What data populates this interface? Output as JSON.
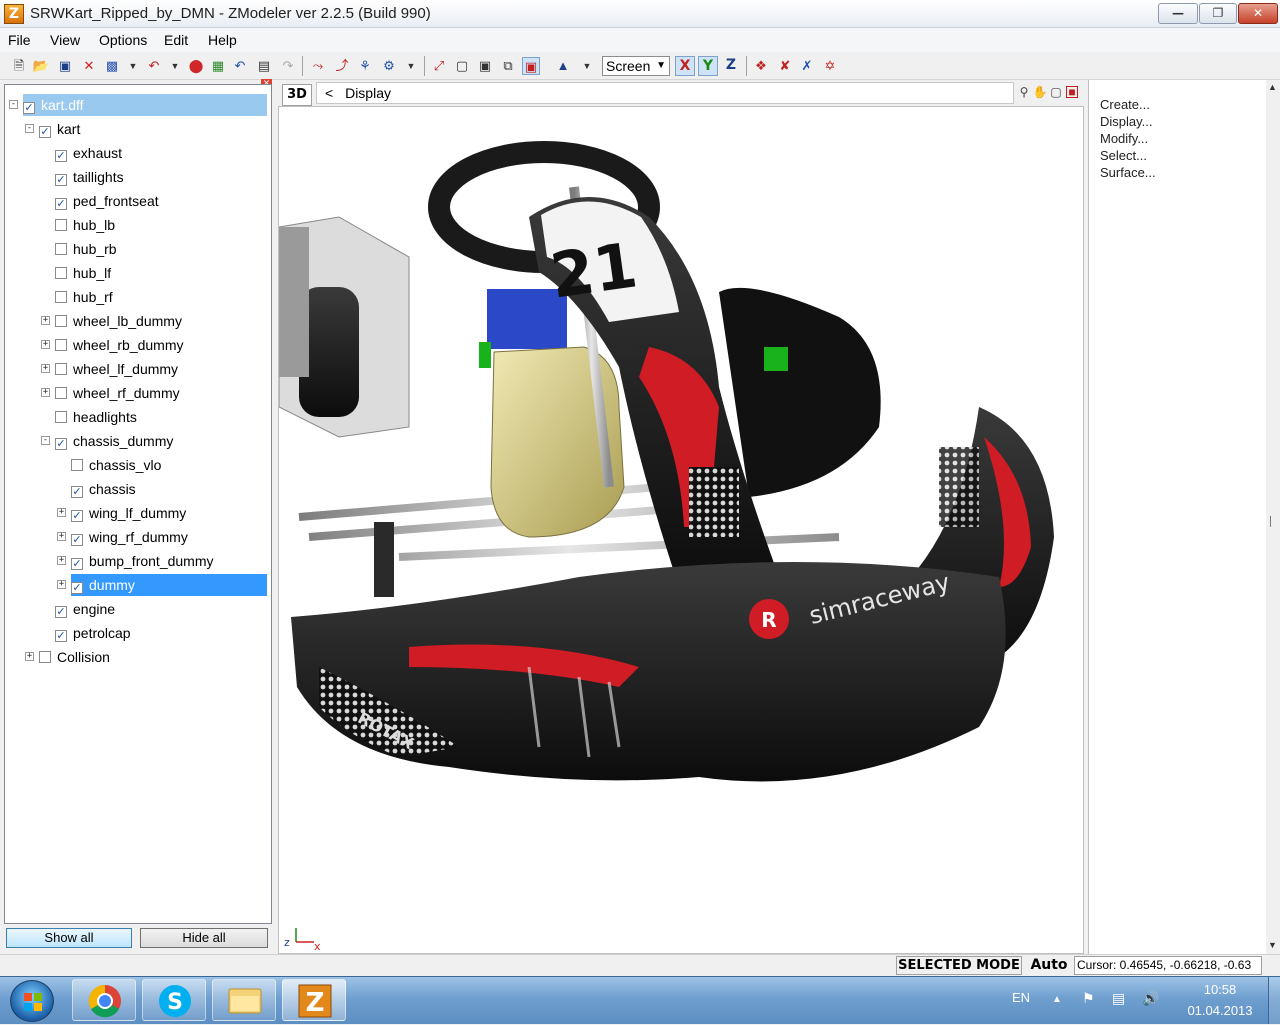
{
  "window": {
    "title": "SRWKart_Ripped_by_DMN - ZModeler ver 2.2.5 (Build 990)",
    "app_icon_letter": "Z"
  },
  "menu": [
    "File",
    "View",
    "Options",
    "Edit",
    "Help"
  ],
  "toolbar": {
    "view_mode": "Screen",
    "axes": [
      "X",
      "Y",
      "Z"
    ]
  },
  "tree": {
    "items": [
      {
        "label": "kart.dff",
        "checked": true,
        "depth": 0,
        "expander": "-",
        "state": "root"
      },
      {
        "label": "kart",
        "checked": true,
        "depth": 1,
        "expander": "-"
      },
      {
        "label": "exhaust",
        "checked": true,
        "depth": 2
      },
      {
        "label": "taillights",
        "checked": true,
        "depth": 2
      },
      {
        "label": "ped_frontseat",
        "checked": true,
        "depth": 2
      },
      {
        "label": "hub_lb",
        "checked": false,
        "depth": 2
      },
      {
        "label": "hub_rb",
        "checked": false,
        "depth": 2
      },
      {
        "label": "hub_lf",
        "checked": false,
        "depth": 2
      },
      {
        "label": "hub_rf",
        "checked": false,
        "depth": 2
      },
      {
        "label": "wheel_lb_dummy",
        "checked": false,
        "depth": 2,
        "expander": "+"
      },
      {
        "label": "wheel_rb_dummy",
        "checked": false,
        "depth": 2,
        "expander": "+"
      },
      {
        "label": "wheel_lf_dummy",
        "checked": false,
        "depth": 2,
        "expander": "+"
      },
      {
        "label": "wheel_rf_dummy",
        "checked": false,
        "depth": 2,
        "expander": "+"
      },
      {
        "label": "headlights",
        "checked": false,
        "depth": 2
      },
      {
        "label": "chassis_dummy",
        "checked": true,
        "depth": 2,
        "expander": "-"
      },
      {
        "label": "chassis_vlo",
        "checked": false,
        "depth": 3
      },
      {
        "label": "chassis",
        "checked": true,
        "depth": 3
      },
      {
        "label": "wing_lf_dummy",
        "checked": true,
        "depth": 3,
        "expander": "+"
      },
      {
        "label": "wing_rf_dummy",
        "checked": true,
        "depth": 3,
        "expander": "+"
      },
      {
        "label": "bump_front_dummy",
        "checked": true,
        "depth": 3,
        "expander": "+"
      },
      {
        "label": "dummy",
        "checked": true,
        "depth": 3,
        "expander": "+",
        "state": "selected"
      },
      {
        "label": "engine",
        "checked": true,
        "depth": 2
      },
      {
        "label": "petrolcap",
        "checked": true,
        "depth": 2
      },
      {
        "label": "Collision",
        "checked": false,
        "depth": 1,
        "expander": "+"
      }
    ],
    "show_all": "Show all",
    "hide_all": "Hide all"
  },
  "viewport": {
    "mode": "3D",
    "nav_back": "<",
    "title": "Display",
    "kart_number": "21",
    "brand_text": "simraceway",
    "logo_letter": "R",
    "side_text": "ROTAX",
    "axis_labels": [
      "z",
      "x"
    ]
  },
  "commands": [
    "Create...",
    "Display...",
    "Modify...",
    "Select...",
    "Surface..."
  ],
  "status": {
    "mode": "SELECTED MODE",
    "auto": "Auto",
    "cursor": "Cursor: 0.46545, -0.66218, -0.63"
  },
  "taskbar": {
    "apps": [
      "chrome-icon",
      "skype-icon",
      "explorer-icon",
      "zmodeler-icon"
    ],
    "lang": "EN",
    "time": "10:58",
    "date": "01.04.2013"
  },
  "colors": {
    "selection": "#3399ff",
    "root_selection": "#99c9ef",
    "kart_red": "#d01c24",
    "tank_yellow": "#d9cf8a"
  }
}
